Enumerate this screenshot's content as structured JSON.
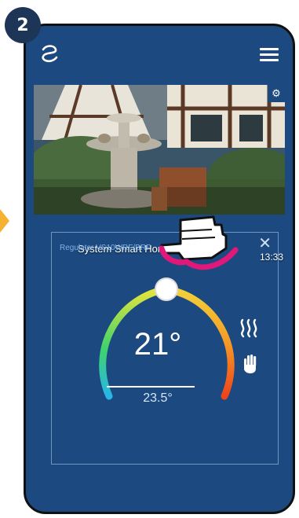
{
  "step": {
    "number": "2"
  },
  "header": {
    "logo_icon": "logo-icon",
    "menu_icon": "hamburger-menu-icon"
  },
  "camera": {
    "name": "System Smart Home",
    "time": "13:33",
    "status_icon": "check-icon",
    "settings_icon": "gear-icon"
  },
  "regulator": {
    "title": "Regulator VS10WRF/BRF",
    "close_icon": "close-icon",
    "set_temperature": "21°",
    "current_temperature": "23.5°",
    "heating_icon": "heating-icon",
    "manual_mode_icon": "hand-icon"
  },
  "colors": {
    "background": "#1c4a80",
    "step_badge": "#1d3557",
    "arrow": "#f5b130",
    "status_ok": "#4caf50",
    "pointer": "#e0187a"
  }
}
